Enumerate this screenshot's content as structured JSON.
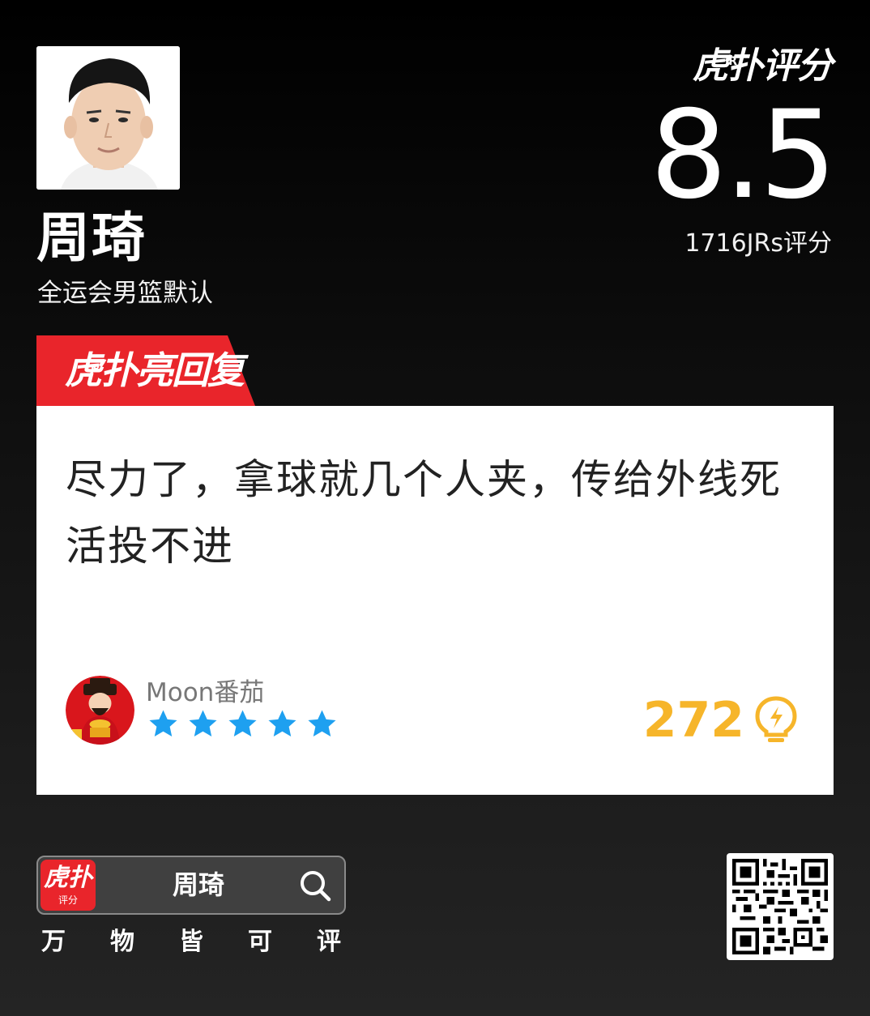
{
  "player": {
    "name": "周琦",
    "subtitle": "全运会男篮默认"
  },
  "rating": {
    "brand": "虎扑评分",
    "brand_mark": "JR",
    "score": "8.5",
    "count_text": "1716JRs评分"
  },
  "highlight_tag": {
    "label": "虎扑亮回复",
    "mark": "JR"
  },
  "comment": {
    "text": "尽力了，拿球就几个人夹，传给外线死活投不进",
    "user_name": "Moon番茄",
    "stars": 5,
    "likes": "272"
  },
  "footer": {
    "app_icon_main": "虎扑",
    "app_icon_sub": "评分",
    "search_text": "周琦",
    "slogan": [
      "万",
      "物",
      "皆",
      "可",
      "评"
    ]
  },
  "colors": {
    "brand_red": "#e9252b",
    "star_blue": "#1ea0f0",
    "like_gold": "#f6b52a"
  },
  "icons": [
    "search-icon",
    "star-icon",
    "lightbulb-icon",
    "qr-code"
  ]
}
